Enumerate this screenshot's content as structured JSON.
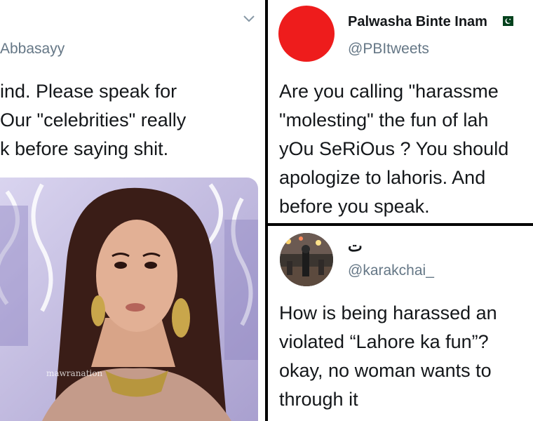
{
  "left_tweet": {
    "handle": "Abbasayy",
    "body_lines": [
      "ind. Please speak for",
      "Our \"celebrities\" really",
      "k before saying shit."
    ],
    "watermark": "mawranation",
    "icons": {
      "chevron": "chevron-down-icon"
    }
  },
  "right_top_tweet": {
    "name": "Palwasha Binte Inam",
    "handle": "@PBItweets",
    "avatar_color": "#ee1c1c",
    "flag_icon": "pakistan-flag-icon",
    "body_lines": [
      "Are you calling \"harassme",
      "\"molesting\" the fun of lah",
      "yOu SeRiOus ? You should",
      "apologize to lahoris. And",
      "before you speak."
    ]
  },
  "right_bottom_tweet": {
    "name": "ت",
    "handle": "@karakchai_",
    "body_lines": [
      "How is being harassed an",
      "violated “Lahore ka fun”?",
      "okay, no woman wants to",
      "through it"
    ]
  },
  "colors": {
    "text": "#14171a",
    "secondary": "#657786",
    "divider": "#000000"
  }
}
